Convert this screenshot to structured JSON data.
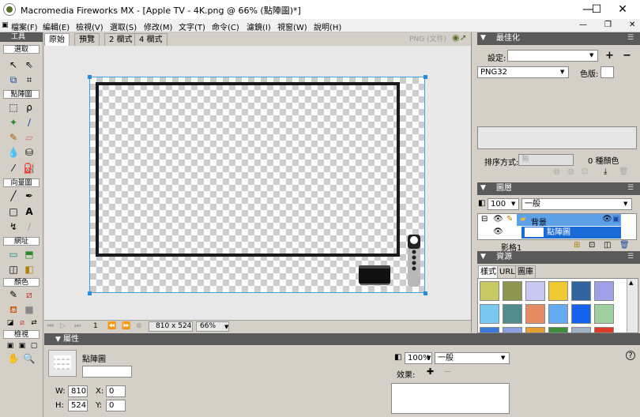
{
  "window": {
    "title": "Macromedia Fireworks MX - [Apple TV - 4K.png @  66% (點陣圖)*]",
    "minimize": "—",
    "maximize": "☐",
    "close": "✕"
  },
  "menu": [
    "檔案(F)",
    "編輯(E)",
    "檢視(V)",
    "選取(S)",
    "修改(M)",
    "文字(T)",
    "命令(C)",
    "濾鏡(I)",
    "視窗(W)",
    "說明(H)"
  ],
  "tools": {
    "title": "工具",
    "sections": {
      "select": "選取",
      "bitmap": "點陣圖",
      "vector": "向量圖",
      "web": "網址",
      "colors": "顏色",
      "view": "檢視"
    }
  },
  "doc": {
    "tabs": [
      "原始",
      "預覽",
      "2 欄式",
      "4 欄式"
    ],
    "active_tab": "原始",
    "export_label": "PNG (文件)"
  },
  "status": {
    "frame": "1",
    "size": "810 x 524",
    "zoom": "66%"
  },
  "optimize": {
    "title": "最佳化",
    "settings_label": "設定:",
    "settings_value": "",
    "format": "PNG32",
    "matte_label": "色版:",
    "sort_label": "排序方式:",
    "sort_value": "無",
    "colors_count": "0 種顏色"
  },
  "layers": {
    "title": "圖層",
    "opacity": "100",
    "blend": "一般",
    "layer_name": "背景",
    "object_name": "點陣圖",
    "frame_label": "影格1"
  },
  "assets": {
    "title": "資源",
    "tabs": [
      "樣式",
      "URL",
      "圖庫"
    ],
    "colors": [
      "#c8c864",
      "#8c9650",
      "#c8c8f0",
      "#f0c832",
      "#3264a0",
      "#a0a0e6",
      "#78c8f0",
      "#508c8c",
      "#e68c64",
      "#64aaf0",
      "#1464f0",
      "#a0d0a0",
      "#3c78dc",
      "#8ca0e6",
      "#e6a032",
      "#3c8c3c",
      "#a0b4c8",
      "#dc3c28"
    ]
  },
  "properties": {
    "title": "屬性",
    "object_type": "點陣圖",
    "name_value": "",
    "w_label": "W:",
    "w": "810",
    "h_label": "H:",
    "h": "524",
    "x_label": "X:",
    "x": "0",
    "y_label": "Y:",
    "y": "0",
    "opacity": "100%",
    "blend": "一般",
    "effects_label": "效果:",
    "help": "?"
  }
}
